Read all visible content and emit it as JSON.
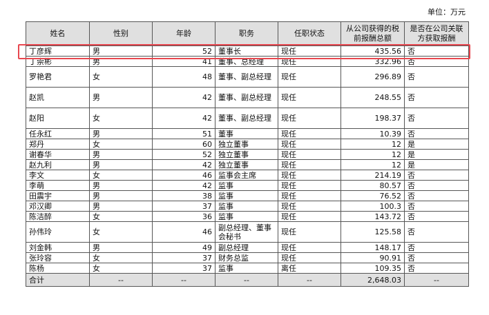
{
  "unit_label": "单位：万元",
  "headers": [
    "姓名",
    "性别",
    "年龄",
    "职务",
    "任职状态",
    "从公司获得的税前报酬总额",
    "是否在公司关联方获取报酬"
  ],
  "rows": [
    {
      "name": "丁彦辉",
      "gender": "男",
      "age": "52",
      "position": "董事长",
      "status": "现任",
      "pay": "435.56",
      "related": "否"
    },
    {
      "name": "丁崇彬",
      "gender": "男",
      "age": "41",
      "position": "董事、总经理",
      "status": "现任",
      "pay": "332.96",
      "related": "否"
    },
    {
      "name": "罗艳君",
      "gender": "女",
      "age": "48",
      "position": "董事、副总经理",
      "status": "现任",
      "pay": "296.89",
      "related": "否"
    },
    {
      "name": "赵凯",
      "gender": "男",
      "age": "42",
      "position": "董事、副总经理",
      "status": "现任",
      "pay": "248.55",
      "related": "否"
    },
    {
      "name": "赵阳",
      "gender": "女",
      "age": "42",
      "position": "董事、副总经理",
      "status": "现任",
      "pay": "198.37",
      "related": "否"
    },
    {
      "name": "任永红",
      "gender": "男",
      "age": "51",
      "position": "董事",
      "status": "现任",
      "pay": "10.39",
      "related": "否"
    },
    {
      "name": "郑丹",
      "gender": "女",
      "age": "60",
      "position": "独立董事",
      "status": "现任",
      "pay": "12",
      "related": "是"
    },
    {
      "name": "谢春华",
      "gender": "男",
      "age": "52",
      "position": "独立董事",
      "status": "现任",
      "pay": "12",
      "related": "是"
    },
    {
      "name": "赵九利",
      "gender": "男",
      "age": "42",
      "position": "独立董事",
      "status": "现任",
      "pay": "12",
      "related": "是"
    },
    {
      "name": "李文",
      "gender": "女",
      "age": "46",
      "position": "监事会主席",
      "status": "现任",
      "pay": "214.19",
      "related": "否"
    },
    {
      "name": "李萌",
      "gender": "男",
      "age": "42",
      "position": "监事",
      "status": "现任",
      "pay": "80.57",
      "related": "否"
    },
    {
      "name": "田震宇",
      "gender": "男",
      "age": "38",
      "position": "监事",
      "status": "现任",
      "pay": "76.52",
      "related": "否"
    },
    {
      "name": "邓汉卿",
      "gender": "男",
      "age": "37",
      "position": "监事",
      "status": "现任",
      "pay": "100.3",
      "related": "否"
    },
    {
      "name": "陈洁醉",
      "gender": "女",
      "age": "36",
      "position": "监事",
      "status": "现任",
      "pay": "143.72",
      "related": "否"
    },
    {
      "name": "孙伟玲",
      "gender": "女",
      "age": "46",
      "position": "副总经理、董事会秘书",
      "status": "现任",
      "pay": "125.58",
      "related": "否"
    },
    {
      "name": "刘金韩",
      "gender": "男",
      "age": "49",
      "position": "副总经理",
      "status": "现任",
      "pay": "148.17",
      "related": "否"
    },
    {
      "name": "张玲容",
      "gender": "女",
      "age": "37",
      "position": "财务总监",
      "status": "现任",
      "pay": "90.91",
      "related": "否"
    },
    {
      "name": "陈杨",
      "gender": "女",
      "age": "37",
      "position": "监事",
      "status": "离任",
      "pay": "109.35",
      "related": "否"
    }
  ],
  "total": {
    "label": "合计",
    "gender": "--",
    "age": "--",
    "position": "--",
    "status": "--",
    "pay": "2,648.03",
    "related": "--"
  },
  "highlight_color": "#e8474f"
}
